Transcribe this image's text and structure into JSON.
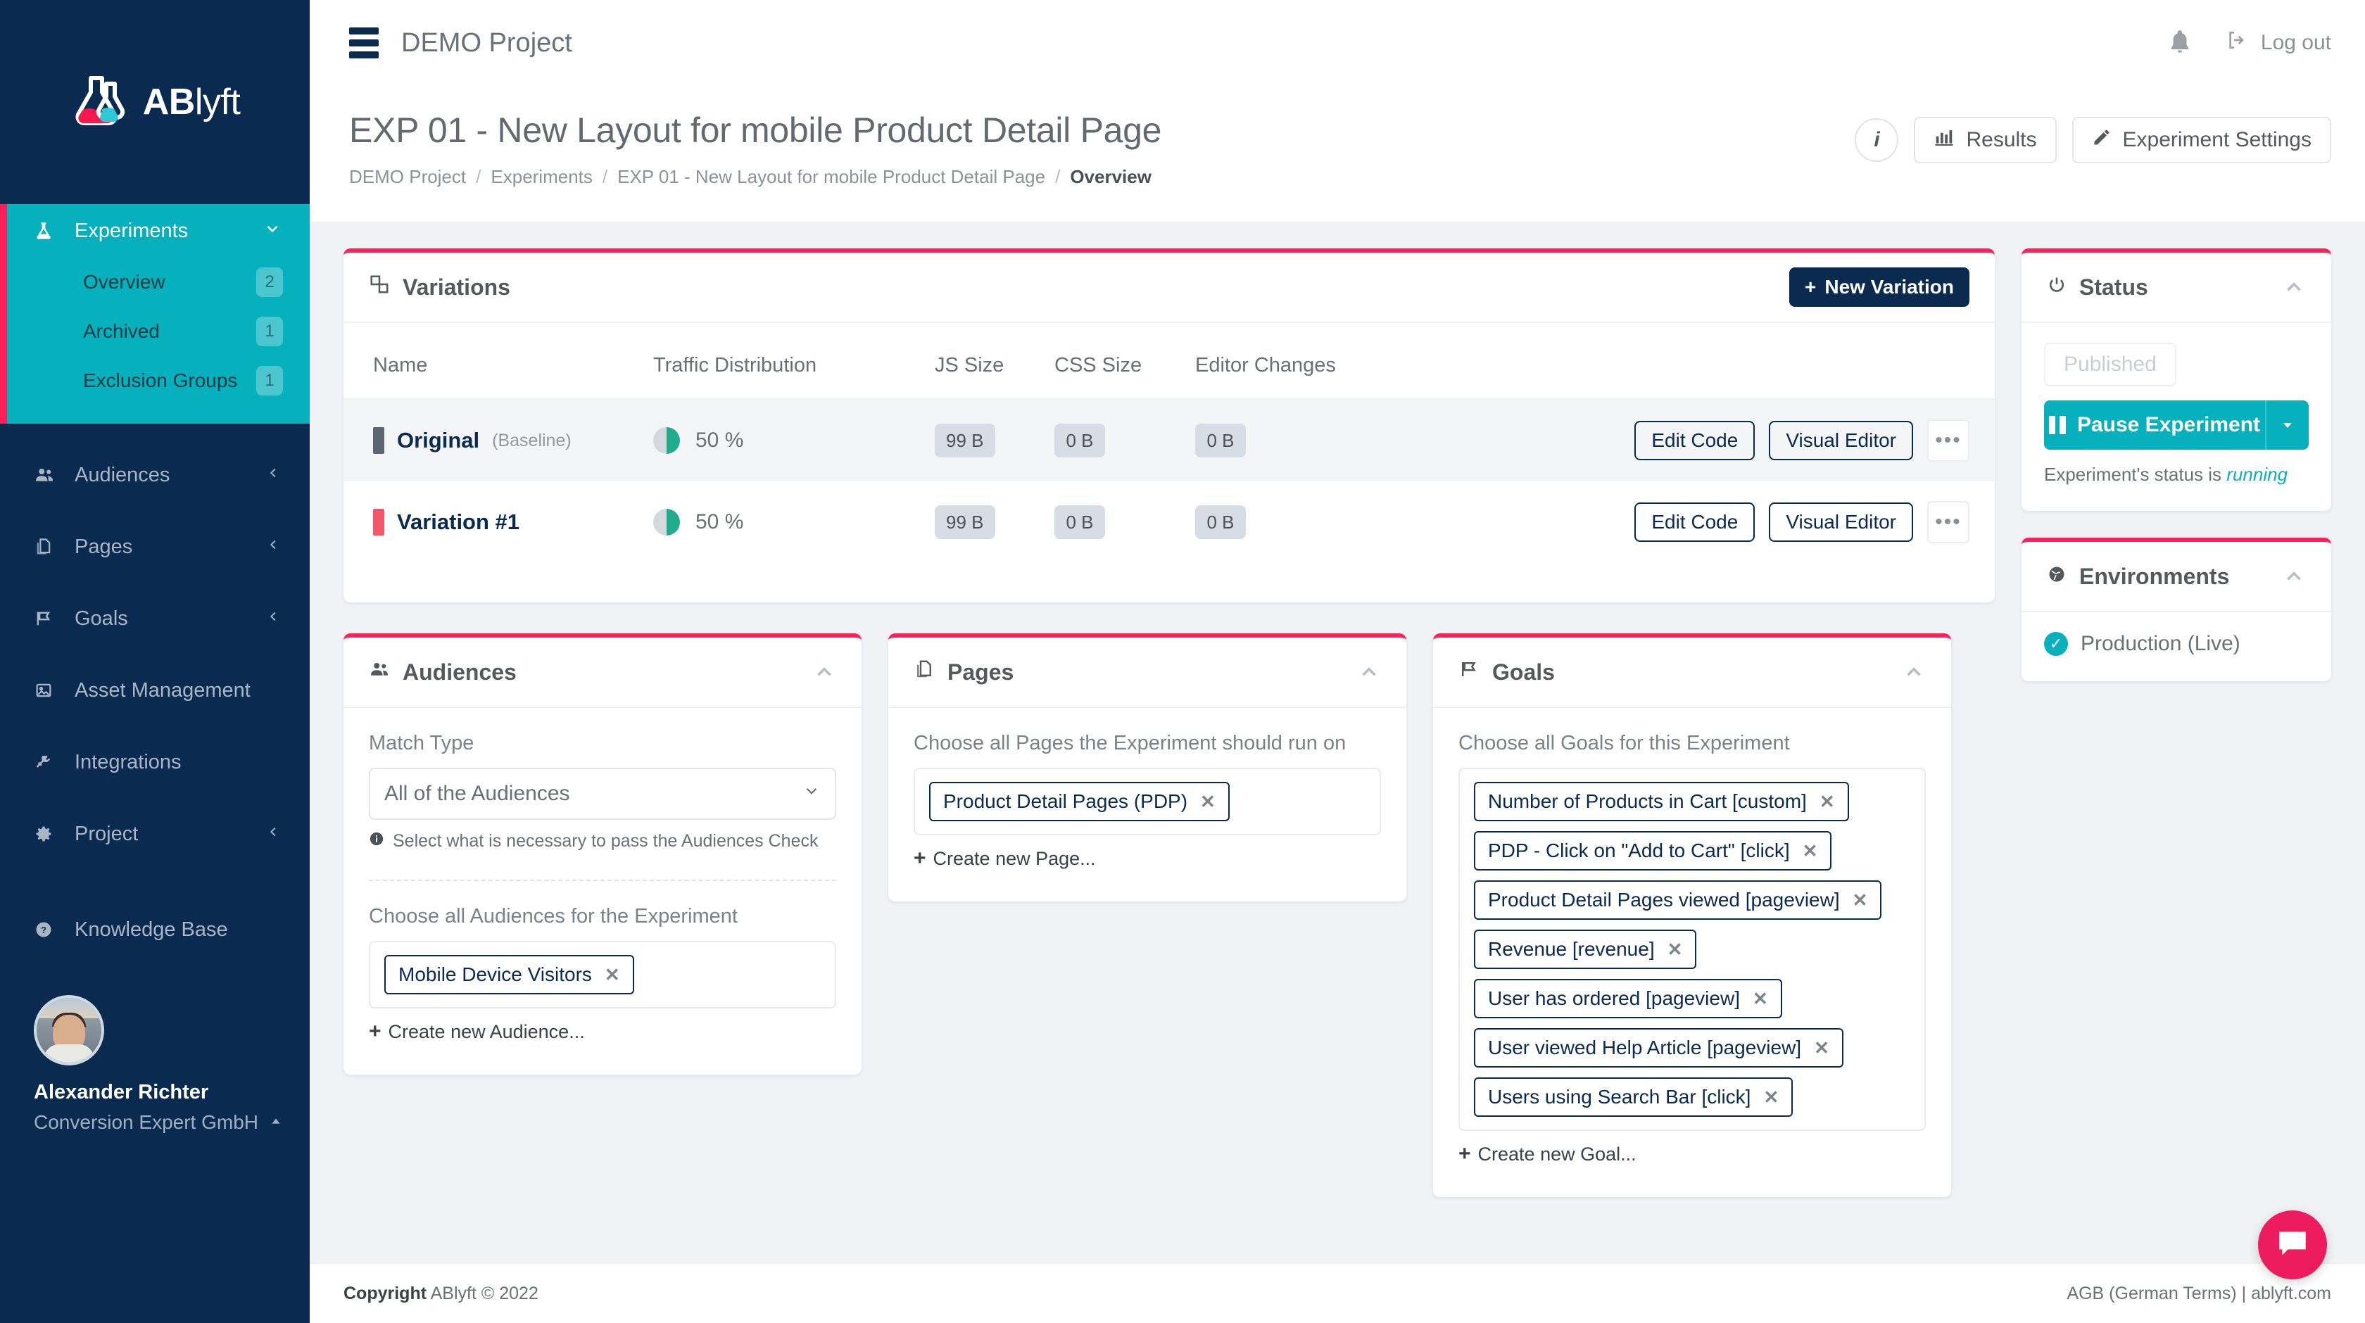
{
  "brand": {
    "name_bold": "AB",
    "name_thin": "lyft",
    "accent_pink": "#fa2059",
    "accent_teal": "#06b0bd",
    "navy": "#0b2a4f"
  },
  "sidebar": {
    "active_group": {
      "label": "Experiments",
      "icon": "flask-icon",
      "chevron": "chevron-down-icon",
      "sub_items": [
        {
          "label": "Overview",
          "badge": "2"
        },
        {
          "label": "Archived",
          "badge": "1"
        },
        {
          "label": "Exclusion Groups",
          "badge": "1"
        }
      ]
    },
    "items": [
      {
        "label": "Audiences",
        "icon": "users-icon",
        "chevron": "chevron-left-icon"
      },
      {
        "label": "Pages",
        "icon": "pages-icon",
        "chevron": "chevron-left-icon"
      },
      {
        "label": "Goals",
        "icon": "flag-icon",
        "chevron": "chevron-left-icon"
      },
      {
        "label": "Asset Management",
        "icon": "image-icon",
        "chevron": ""
      },
      {
        "label": "Integrations",
        "icon": "plug-icon",
        "chevron": ""
      },
      {
        "label": "Project",
        "icon": "gear-icon",
        "chevron": "chevron-left-icon"
      }
    ],
    "knowledge_base": {
      "label": "Knowledge Base",
      "icon": "question-circle-icon"
    },
    "user": {
      "name": "Alexander Richter",
      "organization": "Conversion Expert GmbH",
      "caret": "caret-up-icon"
    }
  },
  "topbar": {
    "menu_icon": "hamburger-icon",
    "project_name": "DEMO Project",
    "bell_icon": "bell-icon",
    "logout_label": "Log out",
    "logout_icon": "logout-icon"
  },
  "page": {
    "title": "EXP 01 - New Layout for mobile Product Detail Page",
    "breadcrumb": [
      "DEMO Project",
      "Experiments",
      "EXP 01 - New Layout for mobile Product Detail Page",
      "Overview"
    ],
    "actions": {
      "info_label": "i",
      "results_label": "Results",
      "results_icon": "bar-chart-icon",
      "settings_label": "Experiment Settings",
      "settings_icon": "pencil-icon"
    }
  },
  "variations": {
    "title": "Variations",
    "icon": "variations-icon",
    "new_button": "New Variation",
    "new_button_icon": "plus-icon",
    "columns": [
      "Name",
      "Traffic Distribution",
      "JS Size",
      "CSS Size",
      "Editor Changes"
    ],
    "rows": [
      {
        "name": "Original",
        "name_suffix": "(Baseline)",
        "swatch_color": "#5c6670",
        "traffic": "50 %",
        "traffic_pct": 50,
        "js_size": "99 B",
        "css_size": "0 B",
        "editor_changes": "0 B",
        "edit_code_label": "Edit Code",
        "visual_editor_label": "Visual Editor",
        "more_label": "•••"
      },
      {
        "name": "Variation #1",
        "name_suffix": "",
        "swatch_color": "#f2586a",
        "traffic": "50 %",
        "traffic_pct": 50,
        "js_size": "99 B",
        "css_size": "0 B",
        "editor_changes": "0 B",
        "edit_code_label": "Edit Code",
        "visual_editor_label": "Visual Editor",
        "more_label": "•••"
      }
    ]
  },
  "audiences": {
    "title": "Audiences",
    "icon": "users-icon",
    "collapse_icon": "chevron-up-icon",
    "match_type_label": "Match Type",
    "match_type_value": "All of the Audiences",
    "hint": "Select what is necessary to pass the Audiences Check",
    "hint_icon": "info-icon",
    "choose_label": "Choose all Audiences for the Experiment",
    "tags": [
      "Mobile Device Visitors"
    ],
    "create_link": "Create new Audience..."
  },
  "pages": {
    "title": "Pages",
    "icon": "pages-icon",
    "collapse_icon": "chevron-up-icon",
    "choose_label": "Choose all Pages the Experiment should run on",
    "tags": [
      "Product Detail Pages (PDP)"
    ],
    "create_link": "Create new Page..."
  },
  "goals": {
    "title": "Goals",
    "icon": "flag-icon",
    "collapse_icon": "chevron-up-icon",
    "choose_label": "Choose all Goals for this Experiment",
    "tags": [
      "Number of Products in Cart [custom]",
      "PDP - Click on \"Add to Cart\" [click]",
      "Product Detail Pages viewed [pageview]",
      "Revenue [revenue]",
      "User has ordered [pageview]",
      "User viewed Help Article [pageview]",
      "Users using Search Bar [click]"
    ],
    "create_link": "Create new Goal..."
  },
  "status": {
    "title": "Status",
    "icon": "power-icon",
    "collapse_icon": "chevron-up-icon",
    "published_chip": "Published",
    "pause_button": "Pause Experiment",
    "pause_icon": "pause-icon",
    "dropdown_icon": "caret-down-icon",
    "note_prefix": "Experiment's status is",
    "note_value": "running"
  },
  "environments": {
    "title": "Environments",
    "icon": "globe-icon",
    "collapse_icon": "chevron-up-icon",
    "items": [
      {
        "label": "Production (Live)",
        "status_icon": "check-circle-icon"
      }
    ]
  },
  "footer": {
    "copyright_bold": "Copyright",
    "copyright_rest": "ABlyft © 2022",
    "right_text": "AGB (German Terms) | ablyft.com"
  },
  "chat": {
    "icon": "chat-bubble-icon"
  }
}
